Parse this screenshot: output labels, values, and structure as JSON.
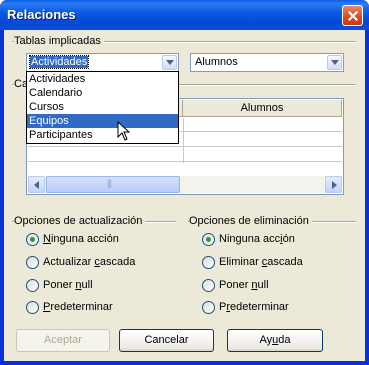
{
  "window": {
    "title": "Relaciones"
  },
  "tables_group": {
    "label": "Tablas implicadas",
    "left_value": "Actividades",
    "right_value": "Alumnos",
    "dropdown_options": [
      "Actividades",
      "Calendario",
      "Cursos",
      "Equipos",
      "Participantes"
    ],
    "highlighted_option": "Equipos"
  },
  "fields_group": {
    "label_partial": "Ca",
    "columns": [
      "",
      "Alumnos"
    ]
  },
  "update_group": {
    "label": "Opciones de actualización",
    "options": [
      {
        "label_pre": "",
        "label_u": "N",
        "label_post": "inguna acción",
        "selected": true
      },
      {
        "label_pre": "Actualizar ",
        "label_u": "c",
        "label_post": "ascada",
        "selected": false
      },
      {
        "label_pre": "Poner ",
        "label_u": "n",
        "label_post": "ull",
        "selected": false
      },
      {
        "label_pre": "",
        "label_u": "P",
        "label_post": "redeterminar",
        "selected": false
      }
    ]
  },
  "delete_group": {
    "label": "Opciones de eliminación",
    "options": [
      {
        "label_pre": "Ninguna acc",
        "label_u": "i",
        "label_post": "ón",
        "selected": true
      },
      {
        "label_pre": "Eliminar ",
        "label_u": "c",
        "label_post": "ascada",
        "selected": false
      },
      {
        "label_pre": "Poner ",
        "label_u": "n",
        "label_post": "ull",
        "selected": false
      },
      {
        "label_pre": "P",
        "label_u": "r",
        "label_post": "edeterminar",
        "selected": false
      }
    ]
  },
  "buttons": {
    "accept": "Aceptar",
    "cancel": "Cancelar",
    "help_pre": "Ay",
    "help_u": "u",
    "help_post": "da"
  }
}
